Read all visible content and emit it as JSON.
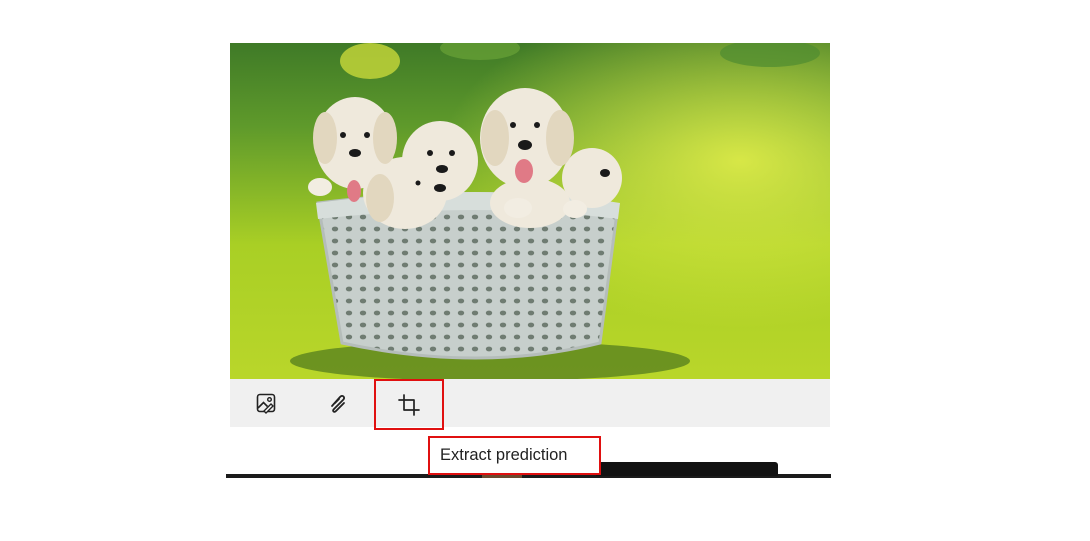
{
  "image": {
    "alt": "puppies-in-basket",
    "icon": "photo-thumbnail"
  },
  "toolbar": {
    "buttons": [
      {
        "icon": "image-edit-icon",
        "label": ""
      },
      {
        "icon": "draw-squiggle-icon",
        "label": ""
      },
      {
        "icon": "crop-icon",
        "label": ""
      }
    ],
    "highlight_color": "#e01010",
    "background": "#f0f0f0"
  },
  "tooltip": {
    "text": "Extract prediction"
  }
}
